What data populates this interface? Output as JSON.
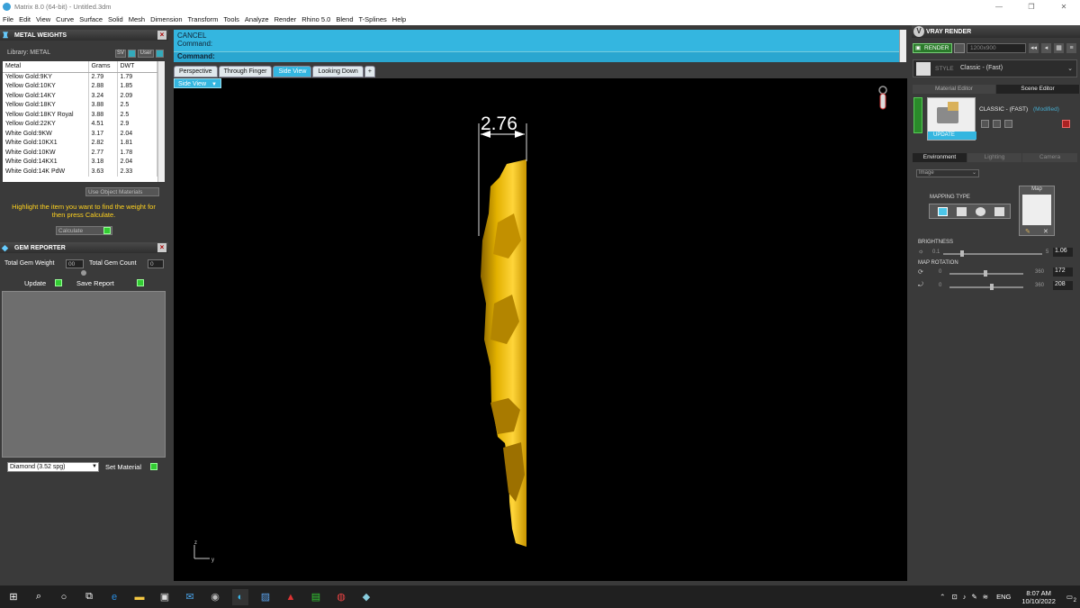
{
  "window": {
    "title": "Matrix 8.0 (64-bit) - Untitled.3dm",
    "controls": [
      "—",
      "❐",
      "✕"
    ]
  },
  "menu": [
    "File",
    "Edit",
    "View",
    "Curve",
    "Surface",
    "Solid",
    "Mesh",
    "Dimension",
    "Transform",
    "Tools",
    "Analyze",
    "Render",
    "Rhino 5.0",
    "Blend",
    "T-Splines",
    "Help"
  ],
  "metal_weights": {
    "title": "METAL WEIGHTS",
    "library_label": "Library: METAL",
    "sv_btn": "SV",
    "user_btn": "User",
    "columns": [
      "Metal",
      "Grams",
      "DWT"
    ],
    "rows": [
      [
        "Yellow Gold:9KY",
        "2.79",
        "1.79"
      ],
      [
        "Yellow Gold:10KY",
        "2.88",
        "1.85"
      ],
      [
        "Yellow Gold:14KY",
        "3.24",
        "2.09"
      ],
      [
        "Yellow Gold:18KY",
        "3.88",
        "2.5"
      ],
      [
        "Yellow Gold:18KY Royal",
        "3.88",
        "2.5"
      ],
      [
        "Yellow Gold:22KY",
        "4.51",
        "2.9"
      ],
      [
        "White Gold:9KW",
        "3.17",
        "2.04"
      ],
      [
        "White Gold:10KX1",
        "2.82",
        "1.81"
      ],
      [
        "White Gold:10KW",
        "2.77",
        "1.78"
      ],
      [
        "White Gold:14KX1",
        "3.18",
        "2.04"
      ],
      [
        "White Gold:14K PdW",
        "3.63",
        "2.33"
      ]
    ],
    "use_object_materials": "Use Object Materials",
    "hint": "Highlight the item you want to find the weight for then press Calculate.",
    "calculate": "Calculate"
  },
  "gem_reporter": {
    "title": "GEM REPORTER",
    "total_gem_weight_label": "Total Gem Weight",
    "total_gem_weight": "00",
    "total_gem_count_label": "Total Gem Count",
    "total_gem_count": "0",
    "update": "Update",
    "save_report": "Save Report",
    "gem_select": "Diamond    (3.52 spg)",
    "set_material": "Set Material"
  },
  "command": {
    "line1": "CANCEL",
    "line2": "Command:",
    "prompt": "Command:"
  },
  "viewport_tabs": [
    "Perspective",
    "Through Finger",
    "Side View",
    "Looking Down",
    "+"
  ],
  "active_tab": "Side View",
  "viewport_label": "Side View",
  "dimension_value": "2.76",
  "axis": {
    "z": "z",
    "y": "y"
  },
  "vray": {
    "title": "VRAY RENDER",
    "render_btn": "RENDER",
    "resolution": "1200x900",
    "style_label": "STYLE",
    "style_value": "Classic - (Fast)",
    "tabs": [
      "Material Editor",
      "Scene Editor"
    ],
    "preset_name": "CLASSIC - (FAST)",
    "modified": "(Modified)",
    "update": "UPDATE",
    "env_tabs": [
      "Environment",
      "Lighting",
      "Camera"
    ],
    "env_type": "Image",
    "mapping_type": "MAPPING TYPE",
    "map_label": "Map",
    "brightness_label": "BRIGHTNESS",
    "brightness_min": "0.1",
    "brightness_max": "5",
    "brightness_value": "1.06",
    "map_rotation_label": "MAP ROTATION",
    "rot1_min": "0",
    "rot1_max": "360",
    "rot1_value": "172",
    "rot2_min": "0",
    "rot2_max": "360",
    "rot2_value": "208"
  },
  "taskbar": {
    "lang": "ENG",
    "time": "8:07 AM",
    "date": "10/10/2022",
    "notification_count": "2"
  }
}
